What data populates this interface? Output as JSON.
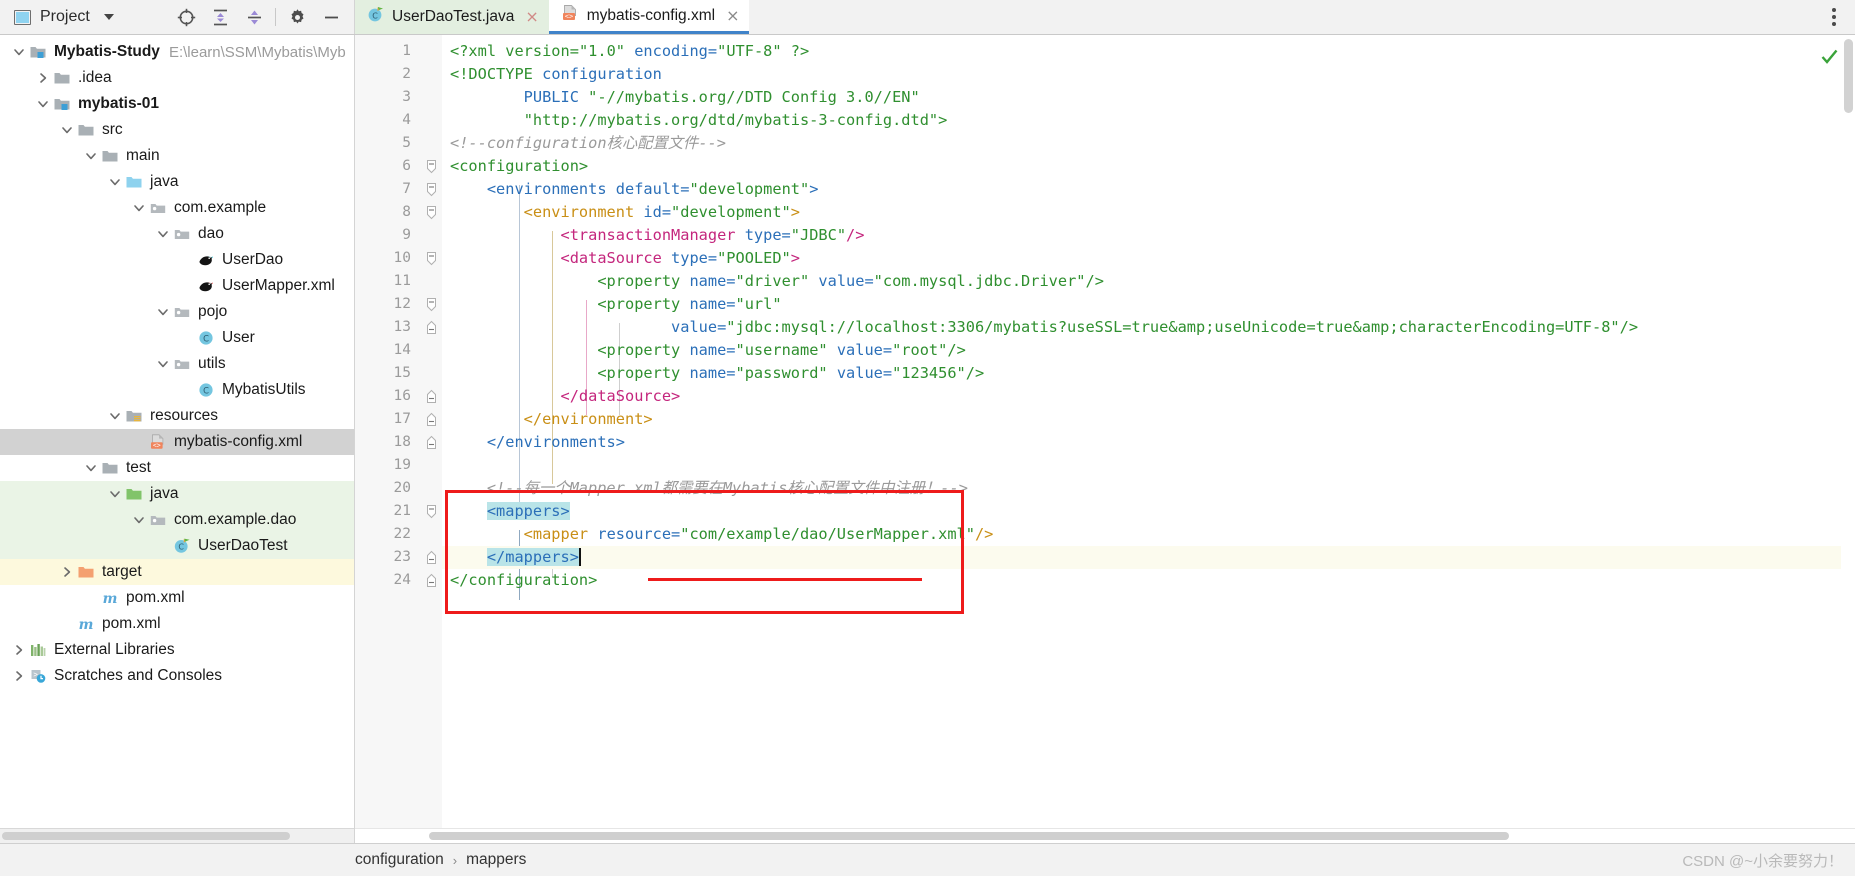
{
  "toolbar": {
    "project_label": "Project",
    "icons": [
      "locate-icon",
      "expand-all-icon",
      "collapse-all-icon",
      "gear-icon",
      "minimize-icon"
    ],
    "more_icon": "more-vertical-icon"
  },
  "tabs": [
    {
      "label": "UserDaoTest.java",
      "icon": "java-test-class-icon",
      "active": false,
      "close": "×"
    },
    {
      "label": "mybatis-config.xml",
      "icon": "xml-file-icon",
      "active": true,
      "close": "×"
    }
  ],
  "sidebar": {
    "scroll": "horizontal-scrollbar",
    "items": [
      {
        "label": "Mybatis-Study",
        "path": "E:\\learn\\SSM\\Mybatis\\Myb",
        "depth": 0,
        "arrow": "down",
        "icon": "module-folder-icon",
        "bold": true,
        "bg": "none"
      },
      {
        "label": ".idea",
        "path": "",
        "depth": 1,
        "arrow": "right",
        "icon": "folder-icon",
        "bold": false,
        "bg": "none"
      },
      {
        "label": "mybatis-01",
        "path": "",
        "depth": 1,
        "arrow": "down",
        "icon": "module-folder-icon",
        "bold": true,
        "bg": "none"
      },
      {
        "label": "src",
        "path": "",
        "depth": 2,
        "arrow": "down",
        "icon": "folder-icon",
        "bold": false,
        "bg": "none"
      },
      {
        "label": "main",
        "path": "",
        "depth": 3,
        "arrow": "down",
        "icon": "folder-icon",
        "bold": false,
        "bg": "none"
      },
      {
        "label": "java",
        "path": "",
        "depth": 4,
        "arrow": "down",
        "icon": "source-root-folder-icon",
        "bold": false,
        "bg": "none"
      },
      {
        "label": "com.example",
        "path": "",
        "depth": 5,
        "arrow": "down",
        "icon": "package-icon",
        "bold": false,
        "bg": "none"
      },
      {
        "label": "dao",
        "path": "",
        "depth": 6,
        "arrow": "down",
        "icon": "package-icon",
        "bold": false,
        "bg": "none"
      },
      {
        "label": "UserDao",
        "path": "",
        "depth": 7,
        "arrow": "none",
        "icon": "mybatis-interface-icon",
        "bold": false,
        "bg": "none"
      },
      {
        "label": "UserMapper.xml",
        "path": "",
        "depth": 7,
        "arrow": "none",
        "icon": "mybatis-mapper-icon",
        "bold": false,
        "bg": "none"
      },
      {
        "label": "pojo",
        "path": "",
        "depth": 6,
        "arrow": "down",
        "icon": "package-icon",
        "bold": false,
        "bg": "none"
      },
      {
        "label": "User",
        "path": "",
        "depth": 7,
        "arrow": "none",
        "icon": "java-class-icon",
        "bold": false,
        "bg": "none"
      },
      {
        "label": "utils",
        "path": "",
        "depth": 6,
        "arrow": "down",
        "icon": "package-icon",
        "bold": false,
        "bg": "none"
      },
      {
        "label": "MybatisUtils",
        "path": "",
        "depth": 7,
        "arrow": "none",
        "icon": "java-class-icon",
        "bold": false,
        "bg": "none"
      },
      {
        "label": "resources",
        "path": "",
        "depth": 4,
        "arrow": "down",
        "icon": "resource-root-folder-icon",
        "bold": false,
        "bg": "none"
      },
      {
        "label": "mybatis-config.xml",
        "path": "",
        "depth": 5,
        "arrow": "none",
        "icon": "xml-file-icon",
        "bold": false,
        "bg": "selected"
      },
      {
        "label": "test",
        "path": "",
        "depth": 3,
        "arrow": "down",
        "icon": "folder-icon",
        "bold": false,
        "bg": "none"
      },
      {
        "label": "java",
        "path": "",
        "depth": 4,
        "arrow": "down",
        "icon": "test-root-folder-icon",
        "bold": false,
        "bg": "test"
      },
      {
        "label": "com.example.dao",
        "path": "",
        "depth": 5,
        "arrow": "down",
        "icon": "package-icon",
        "bold": false,
        "bg": "test"
      },
      {
        "label": "UserDaoTest",
        "path": "",
        "depth": 6,
        "arrow": "none",
        "icon": "java-test-class-icon",
        "bold": false,
        "bg": "test"
      },
      {
        "label": "target",
        "path": "",
        "depth": 2,
        "arrow": "right",
        "icon": "excluded-folder-icon",
        "bold": false,
        "bg": "excluded"
      },
      {
        "label": "pom.xml",
        "path": "",
        "depth": 3,
        "arrow": "none",
        "icon": "maven-icon",
        "bold": false,
        "bg": "none"
      },
      {
        "label": "pom.xml",
        "path": "",
        "depth": 2,
        "arrow": "none",
        "icon": "maven-icon",
        "bold": false,
        "bg": "none"
      },
      {
        "label": "External Libraries",
        "path": "",
        "depth": 0,
        "arrow": "right",
        "icon": "libraries-icon",
        "bold": false,
        "bg": "none"
      },
      {
        "label": "Scratches and Consoles",
        "path": "",
        "depth": 0,
        "arrow": "right",
        "icon": "scratches-icon",
        "bold": false,
        "bg": "none"
      }
    ]
  },
  "editor": {
    "file": "mybatis-config.xml",
    "line_numbers": [
      1,
      2,
      3,
      4,
      5,
      6,
      7,
      8,
      9,
      10,
      11,
      12,
      13,
      14,
      15,
      16,
      17,
      18,
      19,
      20,
      21,
      22,
      23,
      24
    ],
    "lines": [
      {
        "n": 1,
        "tokens": [
          {
            "t": "<?xml version=",
            "c": "tag"
          },
          {
            "t": "\"1.0\"",
            "c": "val"
          },
          {
            "t": " encoding=",
            "c": "attr"
          },
          {
            "t": "\"UTF-8\"",
            "c": "val"
          },
          {
            "t": " ?>",
            "c": "tag"
          }
        ]
      },
      {
        "n": 2,
        "tokens": [
          {
            "t": "<!DOCTYPE ",
            "c": "tag"
          },
          {
            "t": "configuration",
            "c": "attr"
          }
        ]
      },
      {
        "n": 3,
        "tokens": [
          {
            "t": "        PUBLIC ",
            "c": "attr"
          },
          {
            "t": "\"-//mybatis.org//DTD Config 3.0//EN\"",
            "c": "val"
          }
        ]
      },
      {
        "n": 4,
        "tokens": [
          {
            "t": "        ",
            "c": "punc"
          },
          {
            "t": "\"http://mybatis.org/dtd/mybatis-3-config.dtd\">",
            "c": "val"
          }
        ]
      },
      {
        "n": 5,
        "tokens": [
          {
            "t": "<!--configuration核心配置文件-->",
            "c": "cmt"
          }
        ]
      },
      {
        "n": 6,
        "tokens": [
          {
            "t": "<configuration>",
            "c": "tag"
          }
        ]
      },
      {
        "n": 7,
        "tokens": [
          {
            "t": "    <environments ",
            "c": "tagblue"
          },
          {
            "t": "default=",
            "c": "attr"
          },
          {
            "t": "\"development\"",
            "c": "val"
          },
          {
            "t": ">",
            "c": "tagblue"
          }
        ]
      },
      {
        "n": 8,
        "tokens": [
          {
            "t": "        <environment ",
            "c": "tagorange"
          },
          {
            "t": "id=",
            "c": "attr"
          },
          {
            "t": "\"development\"",
            "c": "val"
          },
          {
            "t": ">",
            "c": "tagorange"
          }
        ]
      },
      {
        "n": 9,
        "tokens": [
          {
            "t": "            <transactionManager ",
            "c": "tagpink"
          },
          {
            "t": "type=",
            "c": "attr"
          },
          {
            "t": "\"JDBC\"",
            "c": "val"
          },
          {
            "t": "/>",
            "c": "tagpink"
          }
        ]
      },
      {
        "n": 10,
        "tokens": [
          {
            "t": "            <dataSource ",
            "c": "tagpink"
          },
          {
            "t": "type=",
            "c": "attr"
          },
          {
            "t": "\"POOLED\"",
            "c": "val"
          },
          {
            "t": ">",
            "c": "tagpink"
          }
        ]
      },
      {
        "n": 11,
        "tokens": [
          {
            "t": "                <property ",
            "c": "tag"
          },
          {
            "t": "name=",
            "c": "attr"
          },
          {
            "t": "\"driver\"",
            "c": "val"
          },
          {
            "t": " value=",
            "c": "attr"
          },
          {
            "t": "\"com.mysql.jdbc.Driver\"",
            "c": "val"
          },
          {
            "t": "/>",
            "c": "tag"
          }
        ]
      },
      {
        "n": 12,
        "tokens": [
          {
            "t": "                <property ",
            "c": "tag"
          },
          {
            "t": "name=",
            "c": "attr"
          },
          {
            "t": "\"url\"",
            "c": "val"
          }
        ]
      },
      {
        "n": 13,
        "tokens": [
          {
            "t": "                        value=",
            "c": "attr"
          },
          {
            "t": "\"jdbc:mysql://localhost:3306/mybatis?useSSL=true&amp;useUnicode=true&amp;characterEncoding=UTF-8\"",
            "c": "val"
          },
          {
            "t": "/>",
            "c": "tag"
          }
        ]
      },
      {
        "n": 14,
        "tokens": [
          {
            "t": "                <property ",
            "c": "tag"
          },
          {
            "t": "name=",
            "c": "attr"
          },
          {
            "t": "\"username\"",
            "c": "val"
          },
          {
            "t": " value=",
            "c": "attr"
          },
          {
            "t": "\"root\"",
            "c": "val"
          },
          {
            "t": "/>",
            "c": "tag"
          }
        ]
      },
      {
        "n": 15,
        "tokens": [
          {
            "t": "                <property ",
            "c": "tag"
          },
          {
            "t": "name=",
            "c": "attr"
          },
          {
            "t": "\"password\"",
            "c": "val"
          },
          {
            "t": " value=",
            "c": "attr"
          },
          {
            "t": "\"123456\"",
            "c": "val"
          },
          {
            "t": "/>",
            "c": "tag"
          }
        ]
      },
      {
        "n": 16,
        "tokens": [
          {
            "t": "            </dataSource>",
            "c": "tagpink"
          }
        ]
      },
      {
        "n": 17,
        "tokens": [
          {
            "t": "        </environment>",
            "c": "tagorange"
          }
        ]
      },
      {
        "n": 18,
        "tokens": [
          {
            "t": "    </environments>",
            "c": "tagblue"
          }
        ]
      },
      {
        "n": 19,
        "tokens": []
      },
      {
        "n": 20,
        "tokens": [
          {
            "t": "    <!--每一个Mapper.xml都需要在Mybatis核心配置文件中注册！-->",
            "c": "cmt"
          }
        ]
      },
      {
        "n": 21,
        "tokens": [
          {
            "t": "    ",
            "c": "punc"
          },
          {
            "t": "<mappers>",
            "c": "tagblue",
            "hl": true
          }
        ]
      },
      {
        "n": 22,
        "tokens": [
          {
            "t": "        <mapper ",
            "c": "tagorange"
          },
          {
            "t": "resource=",
            "c": "attr"
          },
          {
            "t": "\"com/example/dao/UserMapper.xml\"",
            "c": "val"
          },
          {
            "t": "/>",
            "c": "tagorange"
          }
        ]
      },
      {
        "n": 23,
        "tokens": [
          {
            "t": "    ",
            "c": "punc"
          },
          {
            "t": "</mappers>",
            "c": "tagblue",
            "hl": true
          },
          {
            "t": "",
            "c": "caret"
          }
        ]
      },
      {
        "n": 24,
        "tokens": [
          {
            "t": "</configuration>",
            "c": "tag"
          }
        ]
      }
    ],
    "inspection_status": "no-errors-check-icon",
    "current_line": 23,
    "annotations": {
      "red_box_label": "mappers-registration-highlight",
      "red_underline_label": "mapper-resource-underline"
    }
  },
  "status_bar": {
    "breadcrumbs": [
      "configuration",
      "mappers"
    ],
    "separator": "›",
    "watermark": "CSDN @~小余要努力！"
  },
  "colors": {
    "accent_blue": "#4083c9",
    "annotation_red": "#ee1b1b",
    "selection_gray": "#d2d2d2",
    "test_green": "#eaf4e6",
    "excluded_yellow": "#fdf9dd",
    "match_highlight": "#b9e4e8"
  }
}
